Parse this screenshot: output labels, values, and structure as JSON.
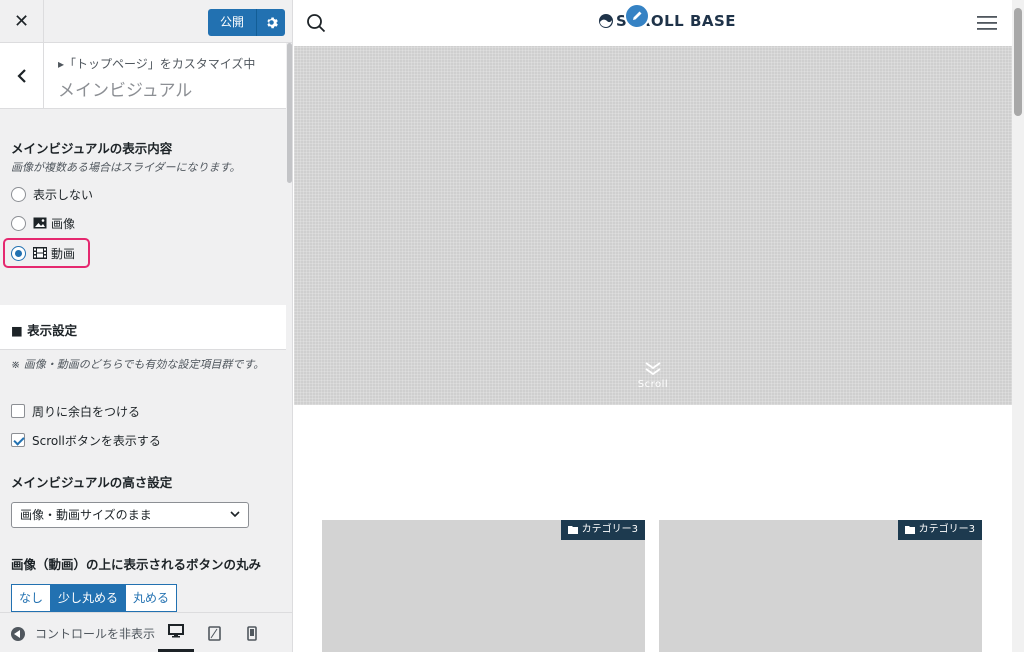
{
  "sidebar": {
    "close_label": "✕",
    "publish_label": "公開",
    "breadcrumb": "▸「トップページ」をカスタマイズ中",
    "section_title": "メインビジュアル",
    "display_content": {
      "title": "メインビジュアルの表示内容",
      "description": "画像が複数ある場合はスライダーになります。",
      "options": [
        {
          "label": "表示しない",
          "icon": "",
          "checked": false
        },
        {
          "label": "画像",
          "icon": "image-icon",
          "checked": false
        },
        {
          "label": "動画",
          "icon": "video-icon",
          "checked": true
        }
      ]
    },
    "display_settings": {
      "heading": "■ 表示設定",
      "note": "※ 画像・動画のどちらでも有効な設定項目群です。",
      "checkboxes": [
        {
          "label": "周りに余白をつける",
          "checked": false
        },
        {
          "label": "Scrollボタンを表示する",
          "checked": true
        }
      ]
    },
    "height_setting": {
      "title": "メインビジュアルの高さ設定",
      "selected": "画像・動画サイズのまま"
    },
    "button_round": {
      "title": "画像（動画）の上に表示されるボタンの丸み",
      "options": [
        "なし",
        "少し丸める",
        "丸める"
      ],
      "selected": "少し丸める"
    },
    "footer": {
      "hide_controls": "コントロールを非表示",
      "devices": [
        "desktop-icon",
        "tablet-icon",
        "mobile-icon"
      ],
      "active_device": "desktop-icon"
    }
  },
  "preview": {
    "logo_text": "SCROLL BASE",
    "scroll_label": "Scroll",
    "cards": [
      {
        "category": "カテゴリー3"
      },
      {
        "category": "カテゴリー3"
      }
    ]
  },
  "colors": {
    "accent": "#2271b1",
    "highlight": "#e5286f",
    "tag_bg": "#1d3a4f"
  }
}
